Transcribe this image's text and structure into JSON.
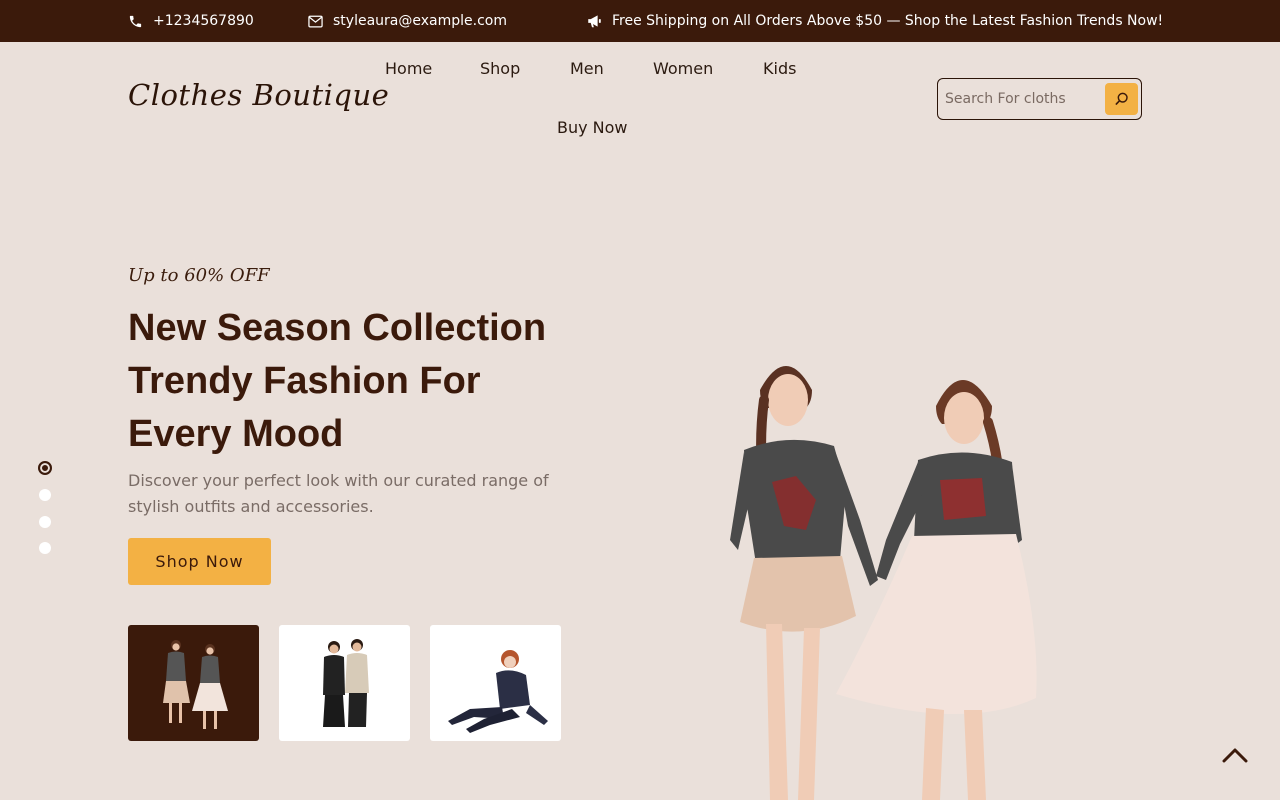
{
  "topbar": {
    "phone": "+1234567890",
    "email": "styleaura@example.com",
    "promo": "Free Shipping on All Orders Above $50 — Shop the Latest Fashion Trends Now!",
    "phone_icon": "phone-icon",
    "email_icon": "mail-icon",
    "promo_icon": "megaphone-icon"
  },
  "header": {
    "logo": "Clothes Boutique",
    "nav": [
      "Home",
      "Shop",
      "Men",
      "Women",
      "Kids",
      "Buy Now"
    ],
    "search": {
      "placeholder": "Search For cloths",
      "icon": "search-icon"
    }
  },
  "hero": {
    "offer": "Up to 60% OFF",
    "headline": [
      "New Season Collection",
      "Trendy Fashion For",
      "Every Mood"
    ],
    "subtitle": "Discover your perfect look with our curated range of stylish outfits and accessories.",
    "cta": "Shop Now",
    "slides_total": 4,
    "active_slide": 1
  },
  "colors": {
    "brand_dark": "#3b1a0b",
    "accent": "#f3b144",
    "background": "#eae0da",
    "muted_text": "#7a6c66"
  },
  "icons": {
    "scroll_top": "chevron-up-icon"
  }
}
